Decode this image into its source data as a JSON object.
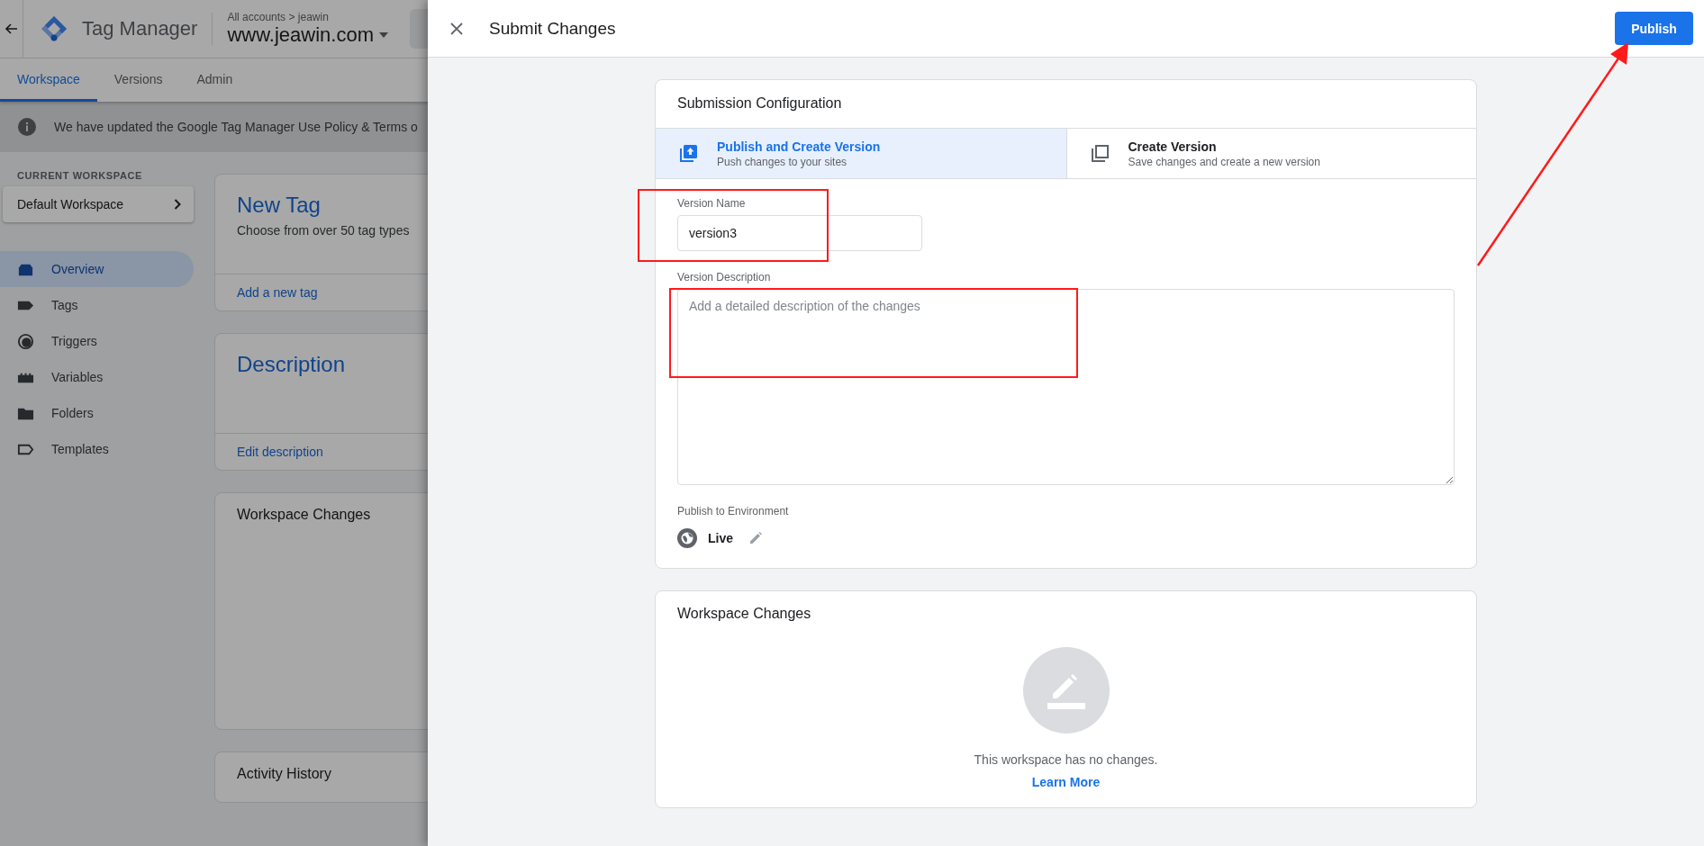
{
  "header": {
    "product": "Tag Manager",
    "breadcrumb": "All accounts > jeawin",
    "container": "www.jeawin.com"
  },
  "tabs": [
    {
      "label": "Workspace",
      "selected": true
    },
    {
      "label": "Versions",
      "selected": false
    },
    {
      "label": "Admin",
      "selected": false
    }
  ],
  "notice": {
    "text": "We have updated the Google Tag Manager Use Policy & Terms o"
  },
  "sidebar": {
    "heading": "CURRENT WORKSPACE",
    "workspace": "Default Workspace",
    "items": [
      {
        "label": "Overview",
        "kind": "overview",
        "selected": true
      },
      {
        "label": "Tags",
        "kind": "tags",
        "selected": false
      },
      {
        "label": "Triggers",
        "kind": "triggers",
        "selected": false
      },
      {
        "label": "Variables",
        "kind": "variables",
        "selected": false
      },
      {
        "label": "Folders",
        "kind": "folders",
        "selected": false
      },
      {
        "label": "Templates",
        "kind": "templates",
        "selected": false
      }
    ]
  },
  "cards": [
    {
      "kind": "feature",
      "title": "New Tag",
      "subtitle": "Choose from over 50 tag types",
      "link": "Add a new tag"
    },
    {
      "kind": "feature",
      "title": "Description",
      "link": "Edit description"
    },
    {
      "kind": "plain",
      "title": "Workspace Changes"
    },
    {
      "kind": "plain",
      "title": "Activity History"
    }
  ],
  "dialog": {
    "title": "Submit Changes",
    "publish_button": "Publish",
    "config": {
      "title": "Submission Configuration",
      "options": [
        {
          "kind": "publish",
          "title": "Publish and Create Version",
          "subtitle": "Push changes to your sites",
          "selected": true
        },
        {
          "kind": "create",
          "title": "Create Version",
          "subtitle": "Save changes and create a new version",
          "selected": false
        }
      ],
      "version_name": {
        "label": "Version Name",
        "value": "version3"
      },
      "version_description": {
        "label": "Version Description",
        "placeholder": "Add a detailed description of the changes"
      },
      "environment": {
        "label": "Publish to Environment",
        "value": "Live"
      }
    },
    "changes": {
      "title": "Workspace Changes",
      "empty_text": "This workspace has no changes.",
      "link": "Learn More"
    }
  }
}
